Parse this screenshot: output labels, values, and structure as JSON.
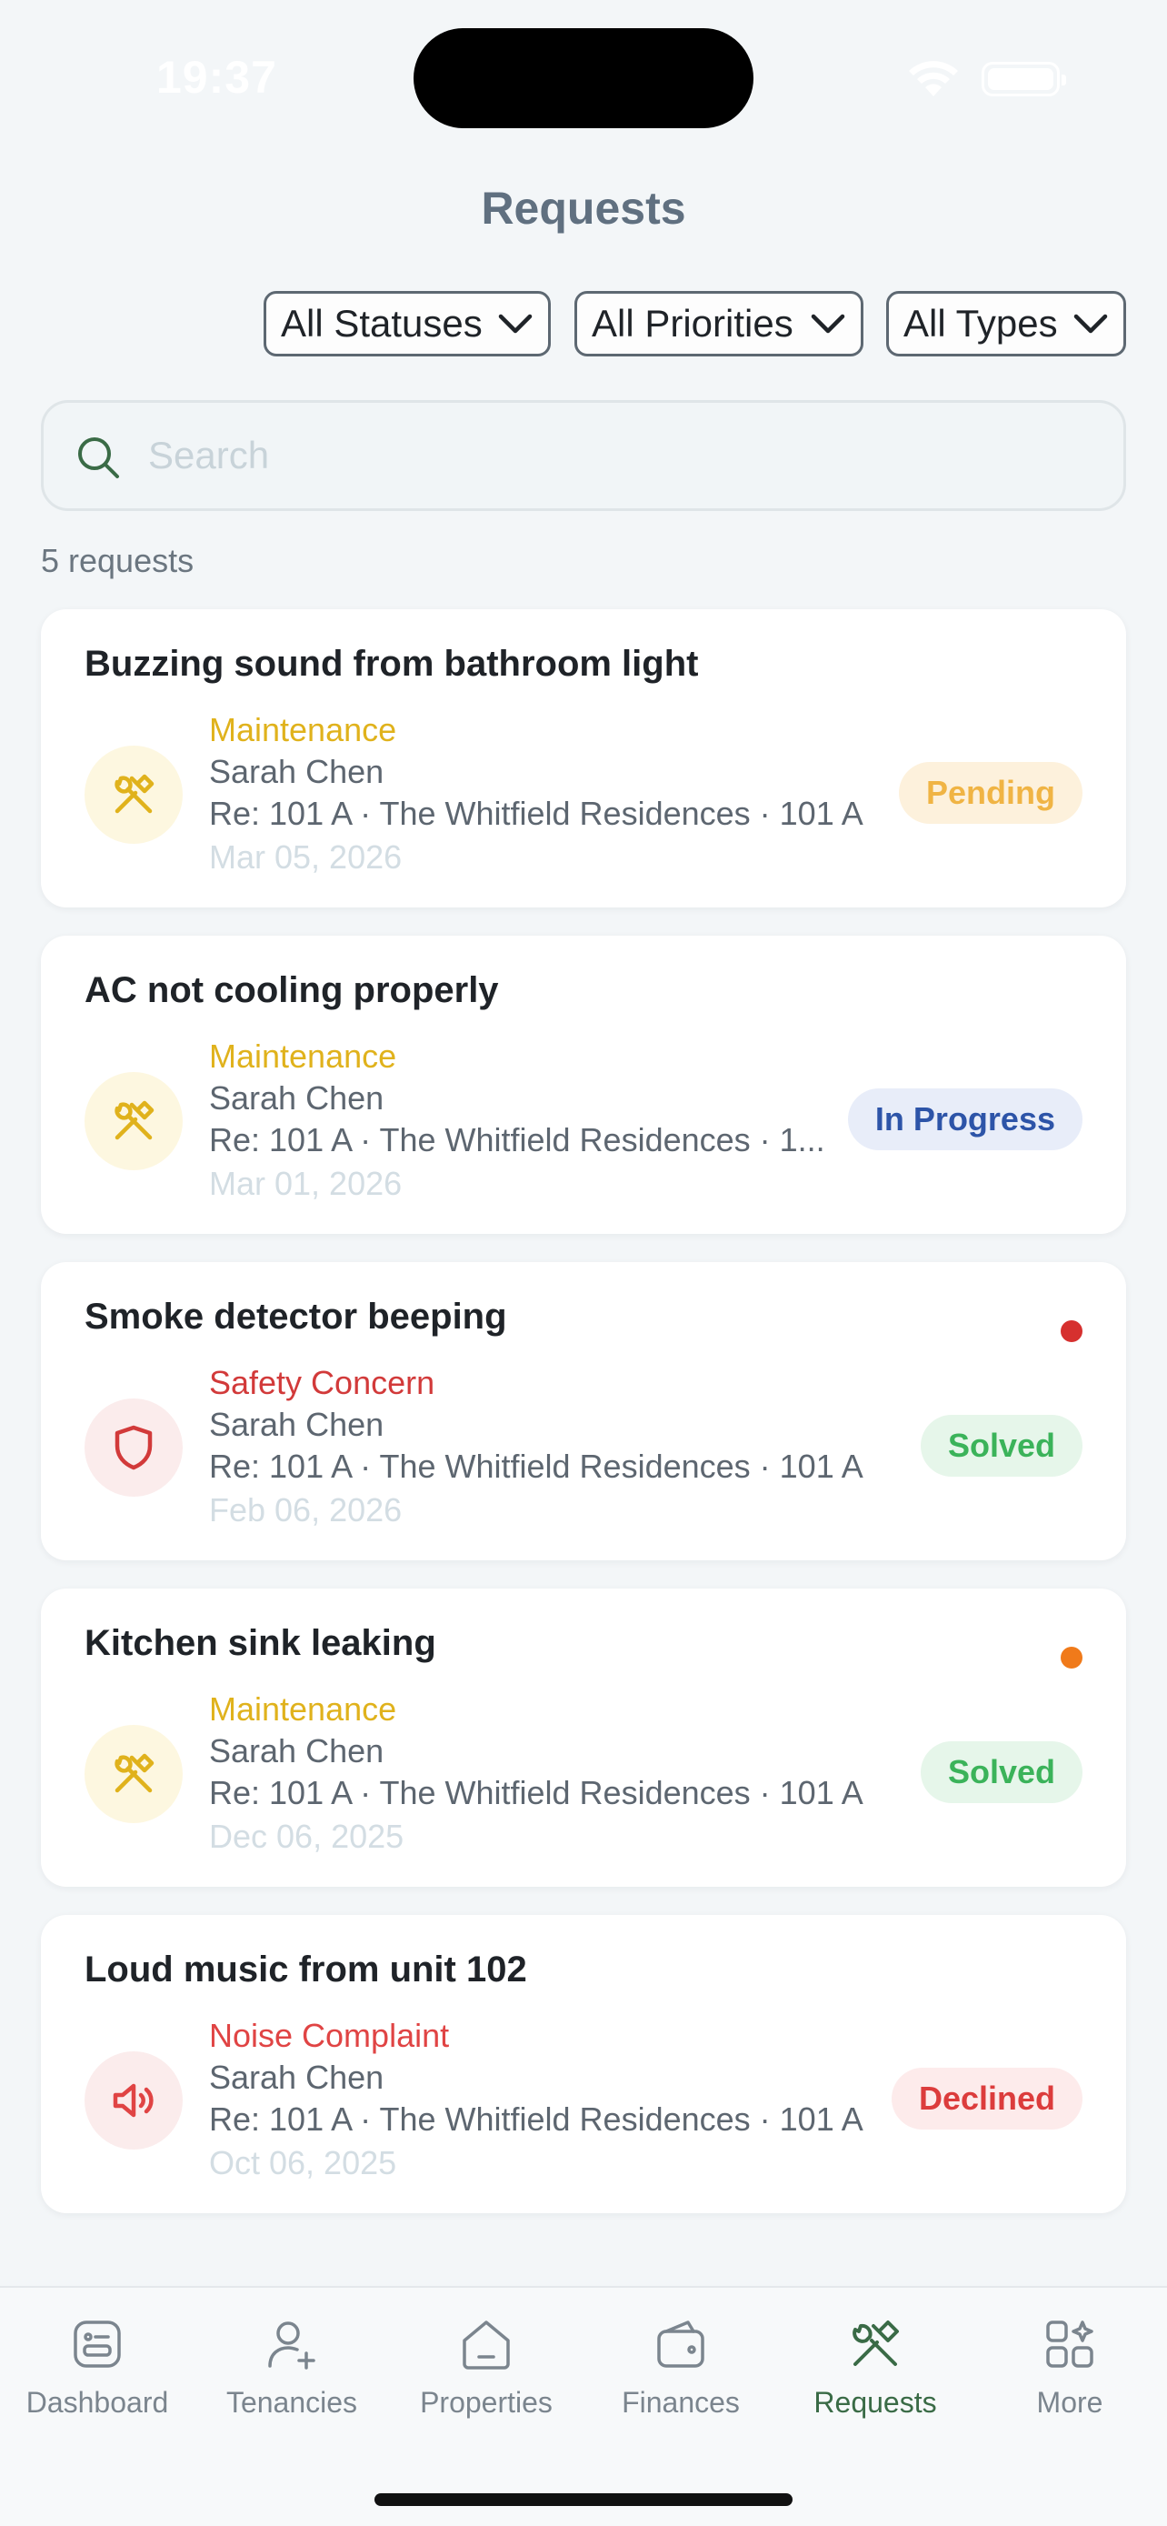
{
  "status_bar": {
    "time": "19:37"
  },
  "header": {
    "title": "Requests"
  },
  "filters": [
    {
      "label": "All Statuses"
    },
    {
      "label": "All Priorities"
    },
    {
      "label": "All Types"
    }
  ],
  "search": {
    "placeholder": "Search",
    "value": ""
  },
  "count_label": "5 requests",
  "colors": {
    "maintenance": "#e0b21c",
    "safety": "#d23a3a",
    "noise": "#e04444",
    "accent_green": "#3a6b46"
  },
  "requests": [
    {
      "title": "Buzzing sound from bathroom light",
      "type": "Maintenance",
      "requester": "Sarah Chen",
      "ref": "Re: 101 A · The Whitfield Residences · 101 A",
      "date": "Mar 05, 2026",
      "status": "Pending",
      "icon": "tools-icon"
    },
    {
      "title": "AC not cooling properly",
      "type": "Maintenance",
      "requester": "Sarah Chen",
      "ref": "Re: 101 A · The Whitfield Residences · 1...",
      "date": "Mar 01, 2026",
      "status": "In Progress",
      "icon": "tools-icon"
    },
    {
      "title": "Smoke detector beeping",
      "type": "Safety Concern",
      "requester": "Sarah Chen",
      "ref": "Re: 101 A · The Whitfield Residences · 101 A",
      "date": "Feb 06, 2026",
      "status": "Solved",
      "icon": "shield-icon",
      "priority_dot": "#d6302f"
    },
    {
      "title": "Kitchen sink leaking",
      "type": "Maintenance",
      "requester": "Sarah Chen",
      "ref": "Re: 101 A · The Whitfield Residences · 101 A",
      "date": "Dec 06, 2025",
      "status": "Solved",
      "icon": "tools-icon",
      "priority_dot": "#f07a1a"
    },
    {
      "title": "Loud music from unit 102",
      "type": "Noise Complaint",
      "requester": "Sarah Chen",
      "ref": "Re: 101 A · The Whitfield Residences · 101 A",
      "date": "Oct 06, 2025",
      "status": "Declined",
      "icon": "speaker-icon"
    }
  ],
  "tabs": [
    {
      "label": "Dashboard",
      "icon": "dashboard-icon"
    },
    {
      "label": "Tenancies",
      "icon": "user-plus-icon"
    },
    {
      "label": "Properties",
      "icon": "home-icon"
    },
    {
      "label": "Finances",
      "icon": "wallet-icon"
    },
    {
      "label": "Requests",
      "icon": "tools-icon",
      "active": true
    },
    {
      "label": "More",
      "icon": "grid-icon"
    }
  ]
}
